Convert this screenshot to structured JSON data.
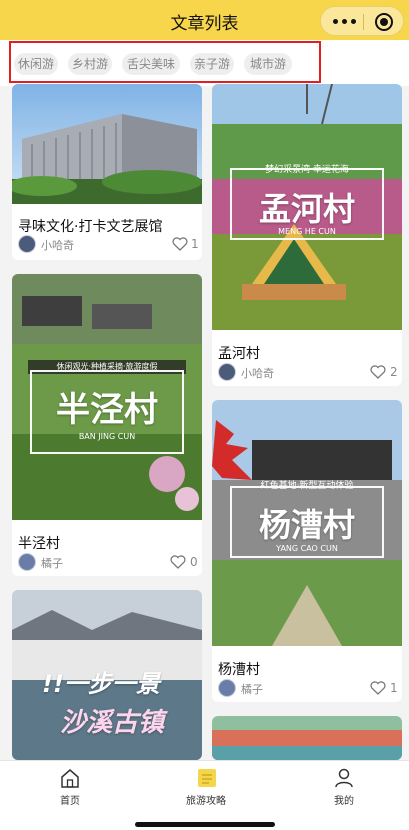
{
  "header": {
    "title": "文章列表"
  },
  "categories": [
    "休闲游",
    "乡村游",
    "舌尖美味",
    "亲子游",
    "城市游"
  ],
  "articles": [
    {
      "title": "寻味文化·打卡文艺展馆",
      "author": "小哈奇",
      "likes": "1"
    },
    {
      "title": "孟河村",
      "author": "小哈奇",
      "likes": "2",
      "overlay": {
        "slogan": "梦幻采景湾·幸运花海",
        "name": "孟河村",
        "pinyin": "MENG HE CUN"
      }
    },
    {
      "title": "半泾村",
      "author": "橘子",
      "likes": "0",
      "overlay": {
        "slogan": "休闲观光·种植采摘·旅游度假",
        "name": "半泾村",
        "pinyin": "BAN JING CUN"
      }
    },
    {
      "title": "杨漕村",
      "author": "橘子",
      "likes": "1",
      "overlay": {
        "slogan": "红色基地·新型互动体验",
        "name": "杨漕村",
        "pinyin": "YANG CAO CUN"
      }
    },
    {
      "overlay": {
        "line1": "!!一步一景",
        "line2": "沙溪古镇"
      }
    }
  ],
  "nav": {
    "home": "首页",
    "guide": "旅游攻略",
    "mine": "我的"
  },
  "colors": {
    "brand": "#f7d64c",
    "highlight": "#e02020"
  }
}
